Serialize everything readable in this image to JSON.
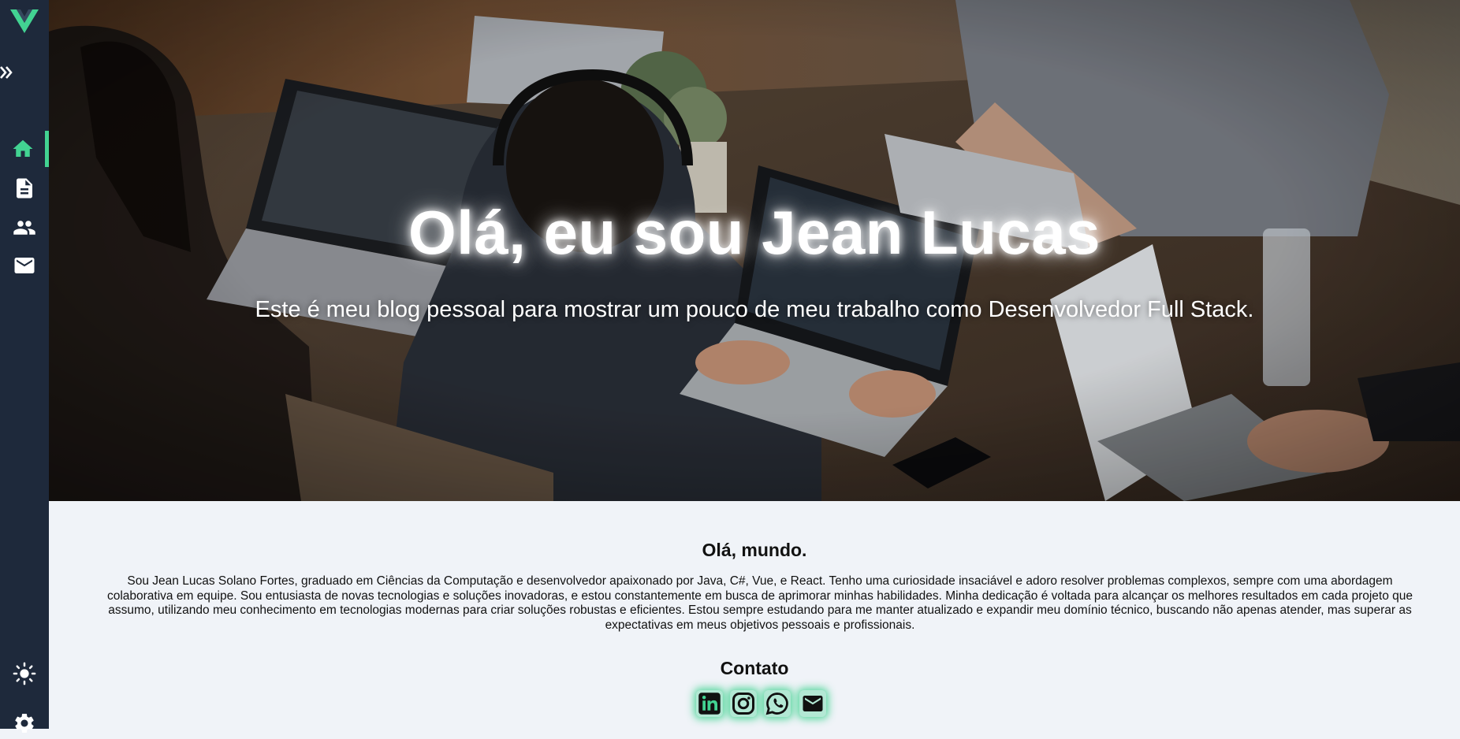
{
  "sidebar": {
    "logo": "vue-logo-icon",
    "toggle": "double-chevron-right-icon",
    "items": [
      {
        "icon": "home-icon",
        "active": true
      },
      {
        "icon": "document-icon",
        "active": false
      },
      {
        "icon": "people-icon",
        "active": false
      },
      {
        "icon": "mail-icon",
        "active": false
      }
    ],
    "bottom": [
      {
        "icon": "sun-icon"
      },
      {
        "icon": "gear-icon"
      }
    ]
  },
  "hero": {
    "title": "Olá, eu sou Jean Lucas",
    "subtitle": "Este é meu blog pessoal para mostrar um pouco de meu trabalho como Desenvolvedor Full Stack."
  },
  "about": {
    "heading": "Olá, mundo.",
    "text": "Sou Jean Lucas Solano Fortes, graduado em Ciências da Computação e desenvolvedor apaixonado por Java, C#, Vue, e React. Tenho uma curiosidade insaciável e adoro resolver problemas complexos, sempre com uma abordagem colaborativa em equipe. Sou entusiasta de novas tecnologias e soluções inovadoras, e estou constantemente em busca de aprimorar minhas habilidades. Minha dedicação é voltada para alcançar os melhores resultados em cada projeto que assumo, utilizando meu conhecimento em tecnologias modernas para criar soluções robustas e eficientes. Estou sempre estudando para me manter atualizado e expandir meu domínio técnico, buscando não apenas atender, mas superar as expectativas em meus objetivos pessoais e profissionais."
  },
  "contact": {
    "heading": "Contato",
    "links": [
      "linkedin-icon",
      "instagram-icon",
      "whatsapp-icon",
      "mail-icon"
    ]
  },
  "colors": {
    "sidebar": "#1e293b",
    "accent": "#42d392",
    "background": "#f0f3f8"
  }
}
